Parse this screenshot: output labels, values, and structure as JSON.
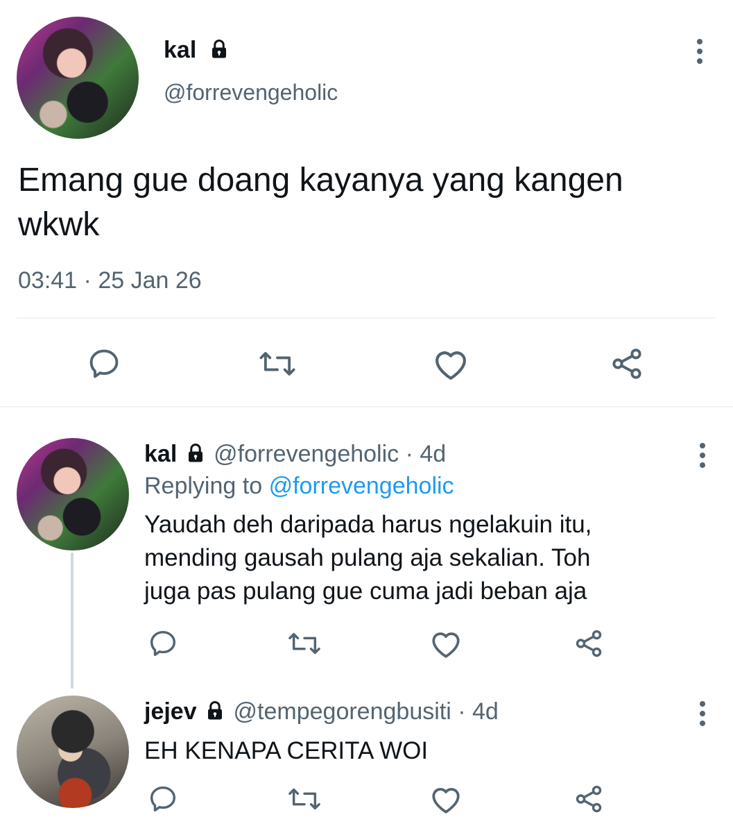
{
  "main_tweet": {
    "display_name": "kal",
    "handle": "@forrevengeholic",
    "text_line1": "Emang gue doang kayanya yang kangen",
    "text_line2": "wkwk",
    "time": "03:41",
    "separator": "·",
    "date": "25 Jan 26"
  },
  "replies": [
    {
      "display_name": "kal",
      "handle": "@forrevengeholic",
      "age": "· 4d",
      "replying_prefix": "Replying to",
      "replying_handle": "@forrevengeholic",
      "text_lines": [
        "Yaudah deh daripada harus ngelakuin itu,",
        "mending gausah pulang aja sekalian. Toh",
        "juga pas pulang gue cuma jadi beban aja"
      ]
    },
    {
      "display_name": "jejev",
      "handle": "@tempegorengbusiti",
      "age": "· 4d",
      "text_lines": [
        "EH KENAPA CERITA WOI"
      ]
    }
  ],
  "icons": {
    "lock": "lock-icon",
    "more": "more-vertical-icon",
    "reply": "reply-icon",
    "retweet": "retweet-icon",
    "like": "heart-icon",
    "share": "share-icon"
  },
  "colors": {
    "text": "#0f1419",
    "secondary": "#536471",
    "link": "#1d9bf0",
    "divider": "#eff3f4"
  }
}
